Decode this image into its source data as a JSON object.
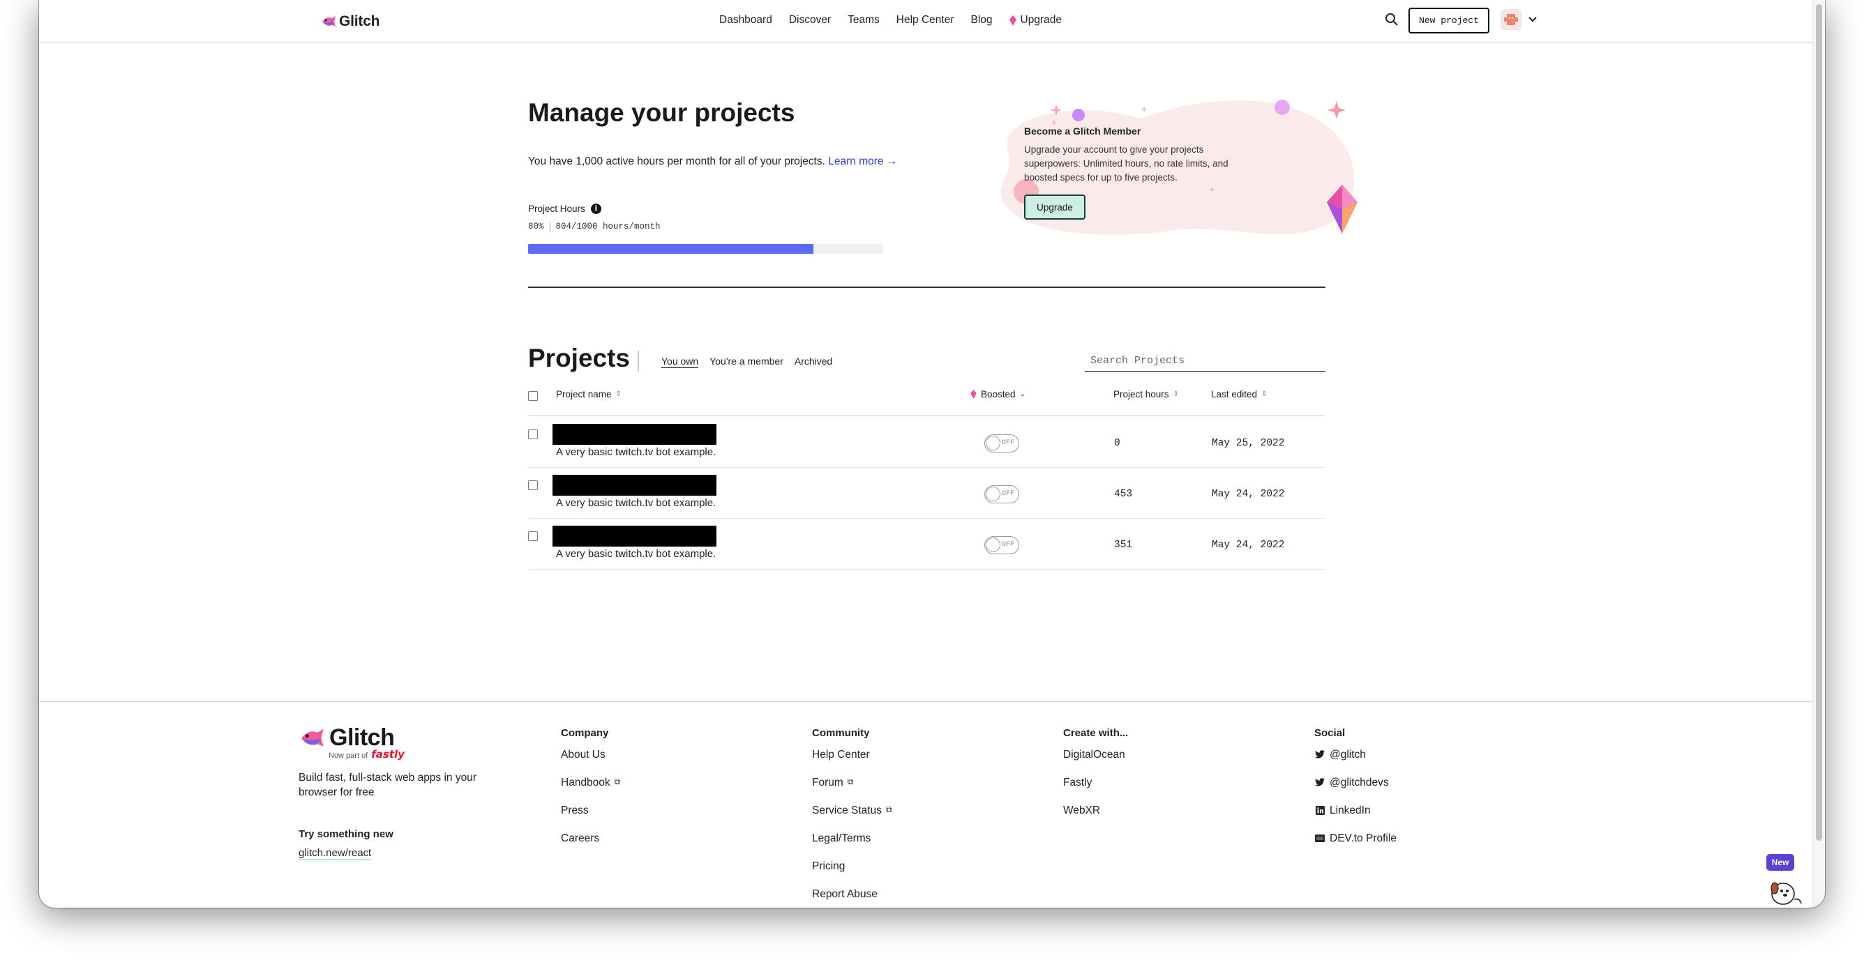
{
  "header": {
    "logo_text": "Glitch",
    "nav": [
      "Dashboard",
      "Discover",
      "Teams",
      "Help Center",
      "Blog",
      "Upgrade"
    ],
    "new_project_label": "New project"
  },
  "manage": {
    "title": "Manage your projects",
    "description": "You have 1,000 active hours per month for all of your projects.",
    "learn_more": "Learn more →",
    "hours_label": "Project Hours",
    "hours_percent": "80%",
    "hours_value": "804/1000 hours/month",
    "hours_fraction": 0.804
  },
  "promo": {
    "title": "Become a Glitch Member",
    "text": "Upgrade your account to give your projects superpowers: Unlimited hours, no rate limits, and boosted specs for up to five projects.",
    "button_label": "Upgrade"
  },
  "projects": {
    "title": "Projects",
    "tabs": [
      "You own",
      "You're a member",
      "Archived"
    ],
    "search_placeholder": "Search Projects",
    "columns": {
      "name": "Project name",
      "boosted": "Boosted",
      "hours": "Project hours",
      "edited": "Last edited"
    },
    "rows": [
      {
        "description": "A very basic twitch.tv bot example.",
        "boosted": "OFF",
        "hours": "0",
        "edited": "May 25, 2022"
      },
      {
        "description": "A very basic twitch.tv bot example.",
        "boosted": "OFF",
        "hours": "453",
        "edited": "May 24, 2022"
      },
      {
        "description": "A very basic twitch.tv bot example.",
        "boosted": "OFF",
        "hours": "351",
        "edited": "May 24, 2022"
      }
    ]
  },
  "footer": {
    "logo_text": "Glitch",
    "part_of": "Now part of",
    "fastly": "fastly",
    "tagline": "Build fast, full-stack web apps in your browser for free",
    "try_title": "Try something new",
    "try_link": "glitch.new/react",
    "company": {
      "title": "Company",
      "links": [
        "About Us",
        "Handbook",
        "Press",
        "Careers"
      ]
    },
    "community": {
      "title": "Community",
      "links": [
        "Help Center",
        "Forum",
        "Service Status",
        "Legal/Terms",
        "Pricing",
        "Report Abuse"
      ]
    },
    "create": {
      "title": "Create with...",
      "links": [
        "DigitalOcean",
        "Fastly",
        "WebXR"
      ]
    },
    "social": {
      "title": "Social",
      "links": [
        "@glitch",
        "@glitchdevs",
        "LinkedIn",
        "DEV.to Profile"
      ]
    }
  },
  "new_badge": "New",
  "colors": {
    "accent_link": "#2f3dd6",
    "progress": "#5a6df2",
    "upgrade_button_bg": "#cdeee5",
    "upgrade_gem": "#e64fa3",
    "new_badge": "#5b41d9"
  }
}
